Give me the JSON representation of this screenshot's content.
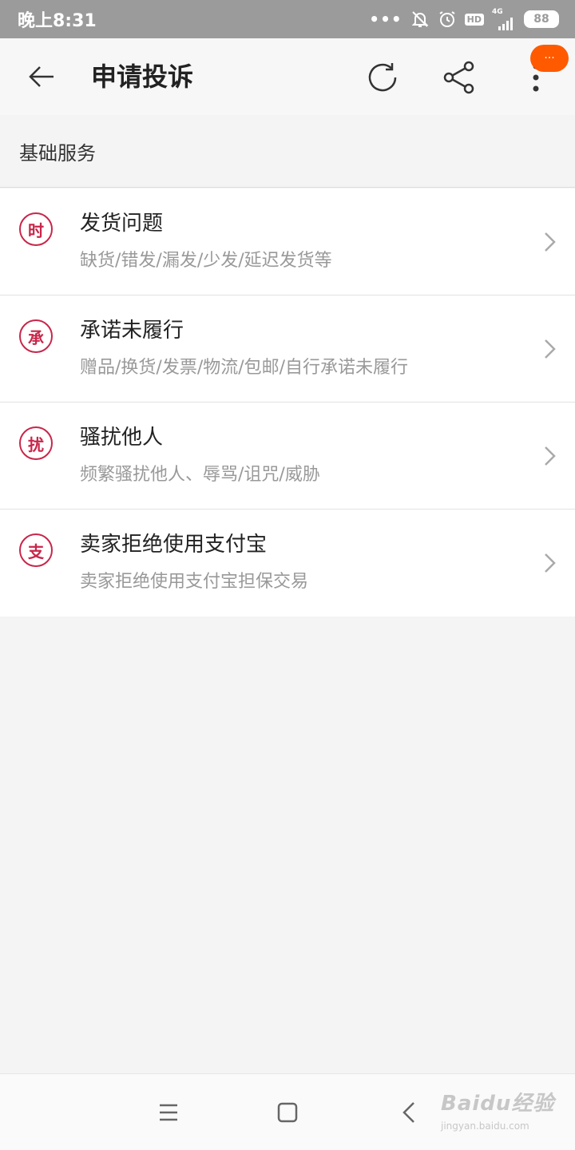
{
  "status_bar": {
    "time": "晚上8:31",
    "dots": "•••",
    "hd": "HD",
    "network": "4G",
    "battery": "88",
    "icons": [
      "mute-bell-icon",
      "alarm-icon",
      "signal-icon"
    ]
  },
  "header": {
    "title": "申请投诉",
    "more_badge": "···",
    "icons": [
      "back-arrow-icon",
      "refresh-icon",
      "share-icon",
      "more-vertical-icon"
    ]
  },
  "section": {
    "title": "基础服务"
  },
  "items": [
    {
      "badge": "时",
      "title": "发货问题",
      "desc": "缺货/错发/漏发/少发/延迟发货等"
    },
    {
      "badge": "承",
      "title": "承诺未履行",
      "desc": "赠品/换货/发票/物流/包邮/自行承诺未履行"
    },
    {
      "badge": "扰",
      "title": "骚扰他人",
      "desc": "频繁骚扰他人、辱骂/诅咒/威胁"
    },
    {
      "badge": "支",
      "title": "卖家拒绝使用支付宝",
      "desc": "卖家拒绝使用支付宝担保交易"
    }
  ],
  "nav": {
    "icons": [
      "menu-icon",
      "home-square-icon",
      "back-chevron-icon"
    ]
  },
  "watermark": {
    "main": "Baidu经验",
    "sub": "jingyan.baidu.com"
  },
  "colors": {
    "accent_red": "#c8264a",
    "badge_orange": "#ff5a00",
    "status_bar_gray": "#9b9b9b"
  }
}
